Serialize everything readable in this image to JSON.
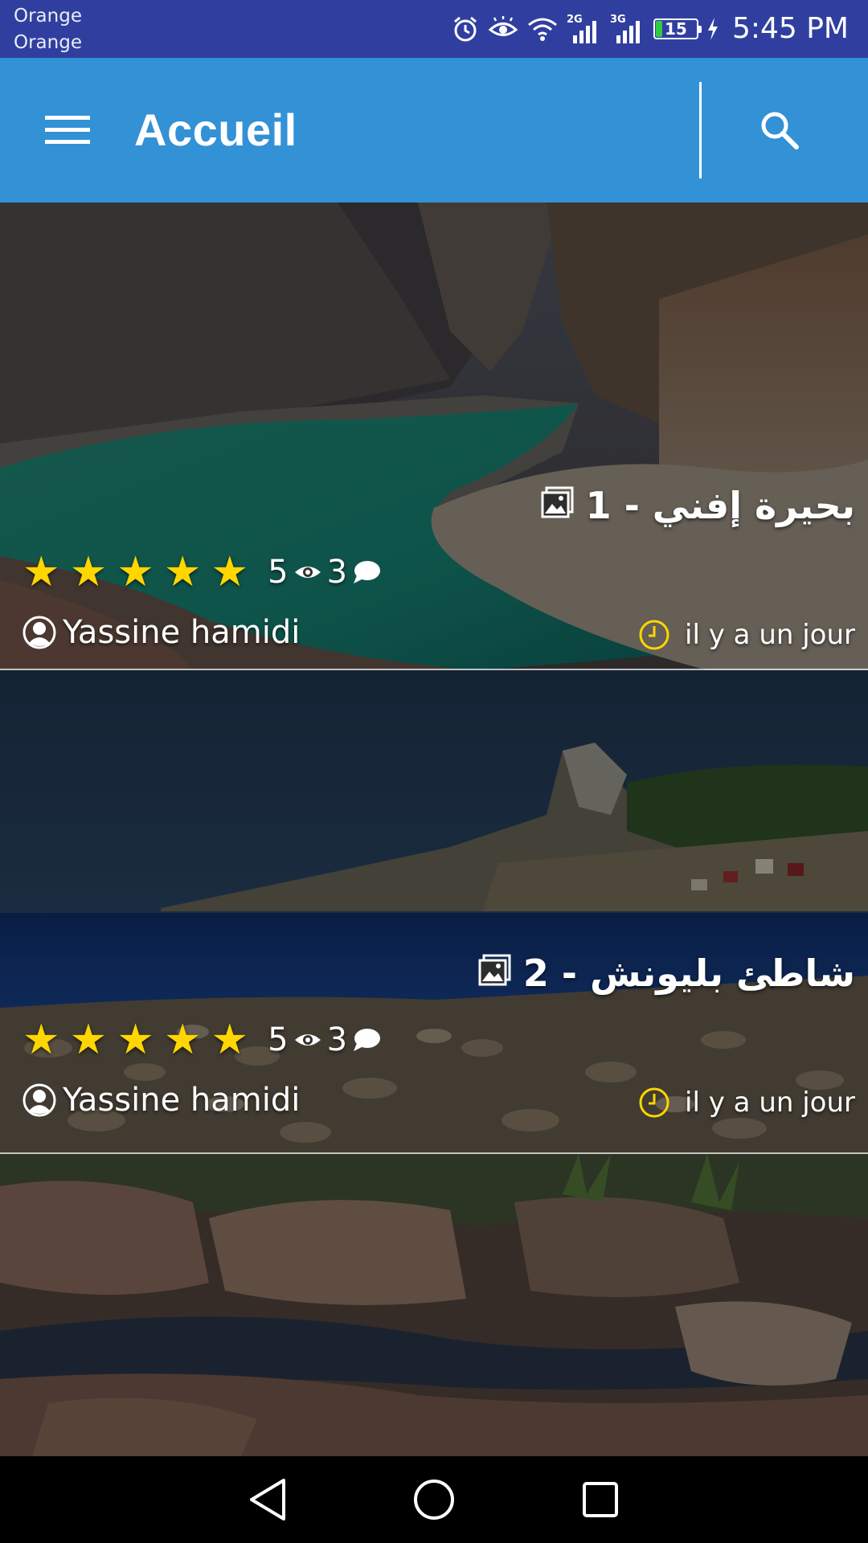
{
  "status_bar": {
    "carrier_1": "Orange",
    "carrier_2": "Orange",
    "network_1": "2G",
    "network_2": "3G",
    "battery": "15",
    "battery_level": 0.15,
    "time": "5:45 PM"
  },
  "app_bar": {
    "title": "Accueil",
    "color": "#3391d6"
  },
  "posts": [
    {
      "number": "1",
      "title": "بحيرة إفني - 1",
      "rating": 5,
      "views": "5",
      "comments": "3",
      "author": "Yassine hamidi",
      "time": "il y a un jour"
    },
    {
      "number": "2",
      "title": "شاطئ بليونش - 2",
      "rating": 5,
      "views": "5",
      "comments": "3",
      "author": "Yassine hamidi",
      "time": "il y a un jour"
    }
  ],
  "colors": {
    "status_bar": "#303f9f",
    "star": "#ffd600",
    "clock_icon": "#ffd600"
  }
}
